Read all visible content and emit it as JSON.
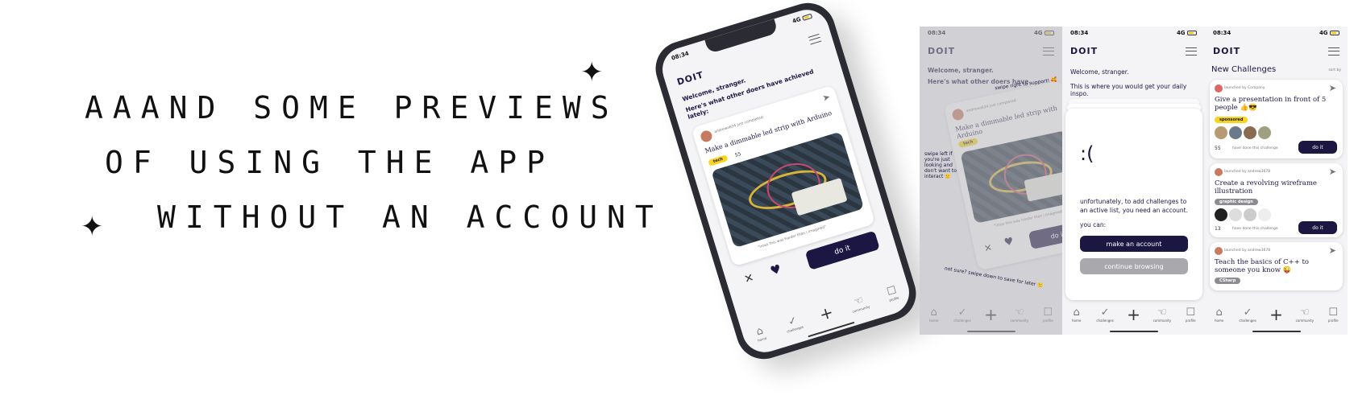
{
  "headline": {
    "line1": "AAAND SOME PREVIEWS",
    "line2": "OF USING THE APP",
    "line3": "WITHOUT AN ACCOUNT"
  },
  "app": {
    "logo": "DOIT",
    "time": "08:34",
    "network": "4G",
    "welcome": "Welcome, stranger.",
    "feed_intro": "Here's what other doers have achieved lately:",
    "daily_intro": "This is where you would get your daily inspo.",
    "completed_user": "andrewo634 just completed:",
    "challenge_title": "Make a dimmable led strip with Arduino",
    "tag_tech": "tech",
    "done_count": "55",
    "photo_caption": "\"Imao this was harder than i imagined\"",
    "do_it": "do it",
    "swipe_right": "swipe right to support! 🥰",
    "swipe_left": "swipe left if you're just looking and don't want to interact 🙁",
    "swipe_down": "not sure? swipe down to save for later 🙂",
    "sad_face": ":(",
    "no_account_msg": "unfortunately, to add challenges to an active list, you need an account.",
    "you_can": "you can:",
    "make_account": "make an account",
    "continue_browsing": "continue browsing",
    "new_challenges": "New Challenges",
    "sort_by": "sort by",
    "challenges": [
      {
        "launched": "launched by Company",
        "title": "Give a presentation in front of 5 people 👍😎",
        "tag": "sponsored",
        "count": "55",
        "done_label": "have done this challenge"
      },
      {
        "launched": "launched by andrew3678",
        "title": "Create a revolving wireframe illustration",
        "tag": "graphic design",
        "count": "13",
        "done_label": "have done this challenge"
      },
      {
        "launched": "launched by andrew3678",
        "title": "Teach the basics of C++ to someone you know 😜",
        "tag": "CSharp",
        "count": "",
        "done_label": ""
      }
    ],
    "tabs": [
      "home",
      "challenges",
      "",
      "community",
      "profile"
    ]
  },
  "colors": {
    "navy": "#1b1642",
    "yellow": "#f7d51d",
    "grey_button": "#a8a8ad"
  }
}
